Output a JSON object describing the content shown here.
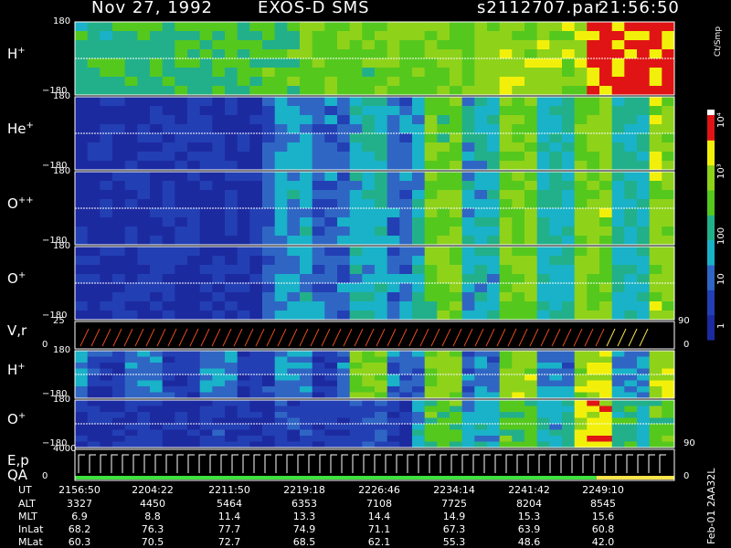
{
  "header": {
    "date": "Nov 27, 1992",
    "instrument": "EXOS-D SMS",
    "file": "s2112707.par",
    "time": "21:56:50"
  },
  "colors": {
    "background": "#000000",
    "low": "#1c2aa0",
    "mid": "#19b2c8",
    "green": "#55c81e",
    "yellow": "#f2f00a",
    "red": "#e01414",
    "trace_red": "#e24a1e",
    "trace_yellow": "#f6e44a",
    "qa_green": "#3ee23e"
  },
  "chart_data": {
    "type": "heatmap",
    "panels": [
      {
        "name": "H",
        "charge": "+",
        "y_top": "180",
        "y_bottom": "−180"
      },
      {
        "name": "He",
        "charge": "+",
        "y_top": "180",
        "y_bottom": "−180"
      },
      {
        "name": "O",
        "charge": "++",
        "y_top": "180",
        "y_bottom": "−180"
      },
      {
        "name": "O",
        "charge": "+",
        "y_top": "180",
        "y_bottom": "−180"
      },
      {
        "name": "V,r",
        "charge": "",
        "y_top": "25",
        "y_bottom": "0",
        "right_top": "90",
        "right_bottom": "0"
      },
      {
        "name": "H",
        "charge": "+",
        "y_top": "180",
        "y_bottom": "−180"
      },
      {
        "name": "O",
        "charge": "+",
        "y_top": "180",
        "y_bottom": "−180",
        "right_bottom": "90"
      },
      {
        "name": "E,p",
        "charge": "",
        "name2": "QA",
        "y_top": "4000",
        "y_bottom": "0",
        "right_bottom": "0"
      }
    ],
    "colorbar": {
      "unit": "Ct/Smp",
      "ticks": [
        "1",
        "10",
        "100",
        "10³",
        "10⁴"
      ],
      "levels": [
        1,
        10,
        100,
        1000,
        10000
      ]
    },
    "time_axis": {
      "label": "UT",
      "ticks": [
        "2156:50",
        "2204:22",
        "2211:50",
        "2219:18",
        "2226:46",
        "2234:14",
        "2241:42",
        "2249:10"
      ]
    },
    "orbit": [
      {
        "label": "ALT",
        "values": [
          "3327",
          "4450",
          "5464",
          "6353",
          "7108",
          "7725",
          "8204",
          "8545"
        ]
      },
      {
        "label": "MLT",
        "values": [
          "6.9",
          "8.8",
          "11.4",
          "13.3",
          "14.4",
          "14.9",
          "15.3",
          "15.6"
        ]
      },
      {
        "label": "InLat",
        "values": [
          "68.2",
          "76.3",
          "77.7",
          "74.9",
          "71.1",
          "67.3",
          "63.9",
          "60.8"
        ]
      },
      {
        "label": "MLat",
        "values": [
          "60.3",
          "70.5",
          "72.7",
          "68.5",
          "62.1",
          "55.3",
          "48.6",
          "42.0"
        ]
      }
    ]
  },
  "footer": {
    "side_label": "Feb-01 2AA32L"
  }
}
